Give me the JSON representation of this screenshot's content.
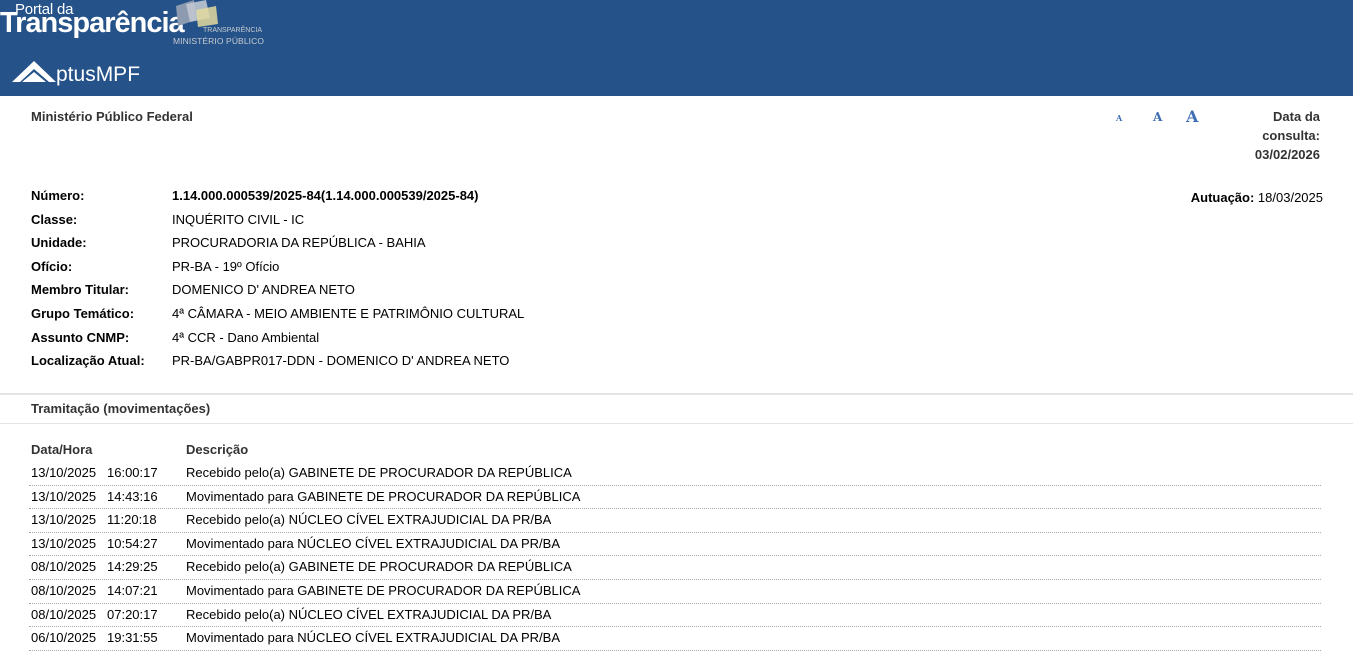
{
  "header": {
    "portal_small": "Portal da",
    "portal_big": "Transparência",
    "mp_line1": "TRANSPARÊNCIA",
    "mp_line2": "MINISTÉRIO PÚBLICO",
    "aptus_text": "ptusMPF",
    "bg_color": "#245289"
  },
  "org": {
    "name": "Ministério Público Federal"
  },
  "font_controls": {
    "small": "A",
    "medium": "A",
    "large": "A"
  },
  "consulta": {
    "label_line1": "Data da",
    "label_line2": "consulta:",
    "date": "03/02/2026"
  },
  "procedure": {
    "autuacao_label": "Autuação:",
    "autuacao_value": "18/03/2025",
    "rows": [
      {
        "label": "Número:",
        "value": "1.14.000.000539/2025-84(1.14.000.000539/2025-84)"
      },
      {
        "label": "Classe:",
        "value": "INQUÉRITO CIVIL - IC"
      },
      {
        "label": "Unidade:",
        "value": "PROCURADORIA DA REPÚBLICA - BAHIA"
      },
      {
        "label": "Ofício:",
        "value": "PR-BA - 19º Ofício"
      },
      {
        "label": "Membro Titular:",
        "value": "DOMENICO D' ANDREA NETO"
      },
      {
        "label": "Grupo Temático:",
        "value": "4ª CÂMARA - MEIO AMBIENTE E PATRIMÔNIO CULTURAL"
      },
      {
        "label": "Assunto CNMP:",
        "value": "4ª CCR - Dano Ambiental"
      },
      {
        "label": "Localização Atual:",
        "value": "PR-BA/GABPR017-DDN - DOMENICO D' ANDREA NETO"
      }
    ]
  },
  "tramitacao": {
    "title": "Tramitação (movimentações)",
    "col_date": "Data/Hora",
    "col_desc": "Descrição",
    "rows": [
      {
        "date": "13/10/2025",
        "time": "16:00:17",
        "desc": "Recebido pelo(a) GABINETE DE PROCURADOR DA REPÚBLICA"
      },
      {
        "date": "13/10/2025",
        "time": "14:43:16",
        "desc": "Movimentado para GABINETE DE PROCURADOR DA REPÚBLICA"
      },
      {
        "date": "13/10/2025",
        "time": "11:20:18",
        "desc": "Recebido pelo(a) NÚCLEO CÍVEL EXTRAJUDICIAL DA PR/BA"
      },
      {
        "date": "13/10/2025",
        "time": "10:54:27",
        "desc": "Movimentado para NÚCLEO CÍVEL EXTRAJUDICIAL DA PR/BA"
      },
      {
        "date": "08/10/2025",
        "time": "14:29:25",
        "desc": "Recebido pelo(a) GABINETE DE PROCURADOR DA REPÚBLICA"
      },
      {
        "date": "08/10/2025",
        "time": "14:07:21",
        "desc": "Movimentado para GABINETE DE PROCURADOR DA REPÚBLICA"
      },
      {
        "date": "08/10/2025",
        "time": "07:20:17",
        "desc": "Recebido pelo(a) NÚCLEO CÍVEL EXTRAJUDICIAL DA PR/BA"
      },
      {
        "date": "06/10/2025",
        "time": "19:31:55",
        "desc": "Movimentado para NÚCLEO CÍVEL EXTRAJUDICIAL DA PR/BA"
      }
    ]
  }
}
